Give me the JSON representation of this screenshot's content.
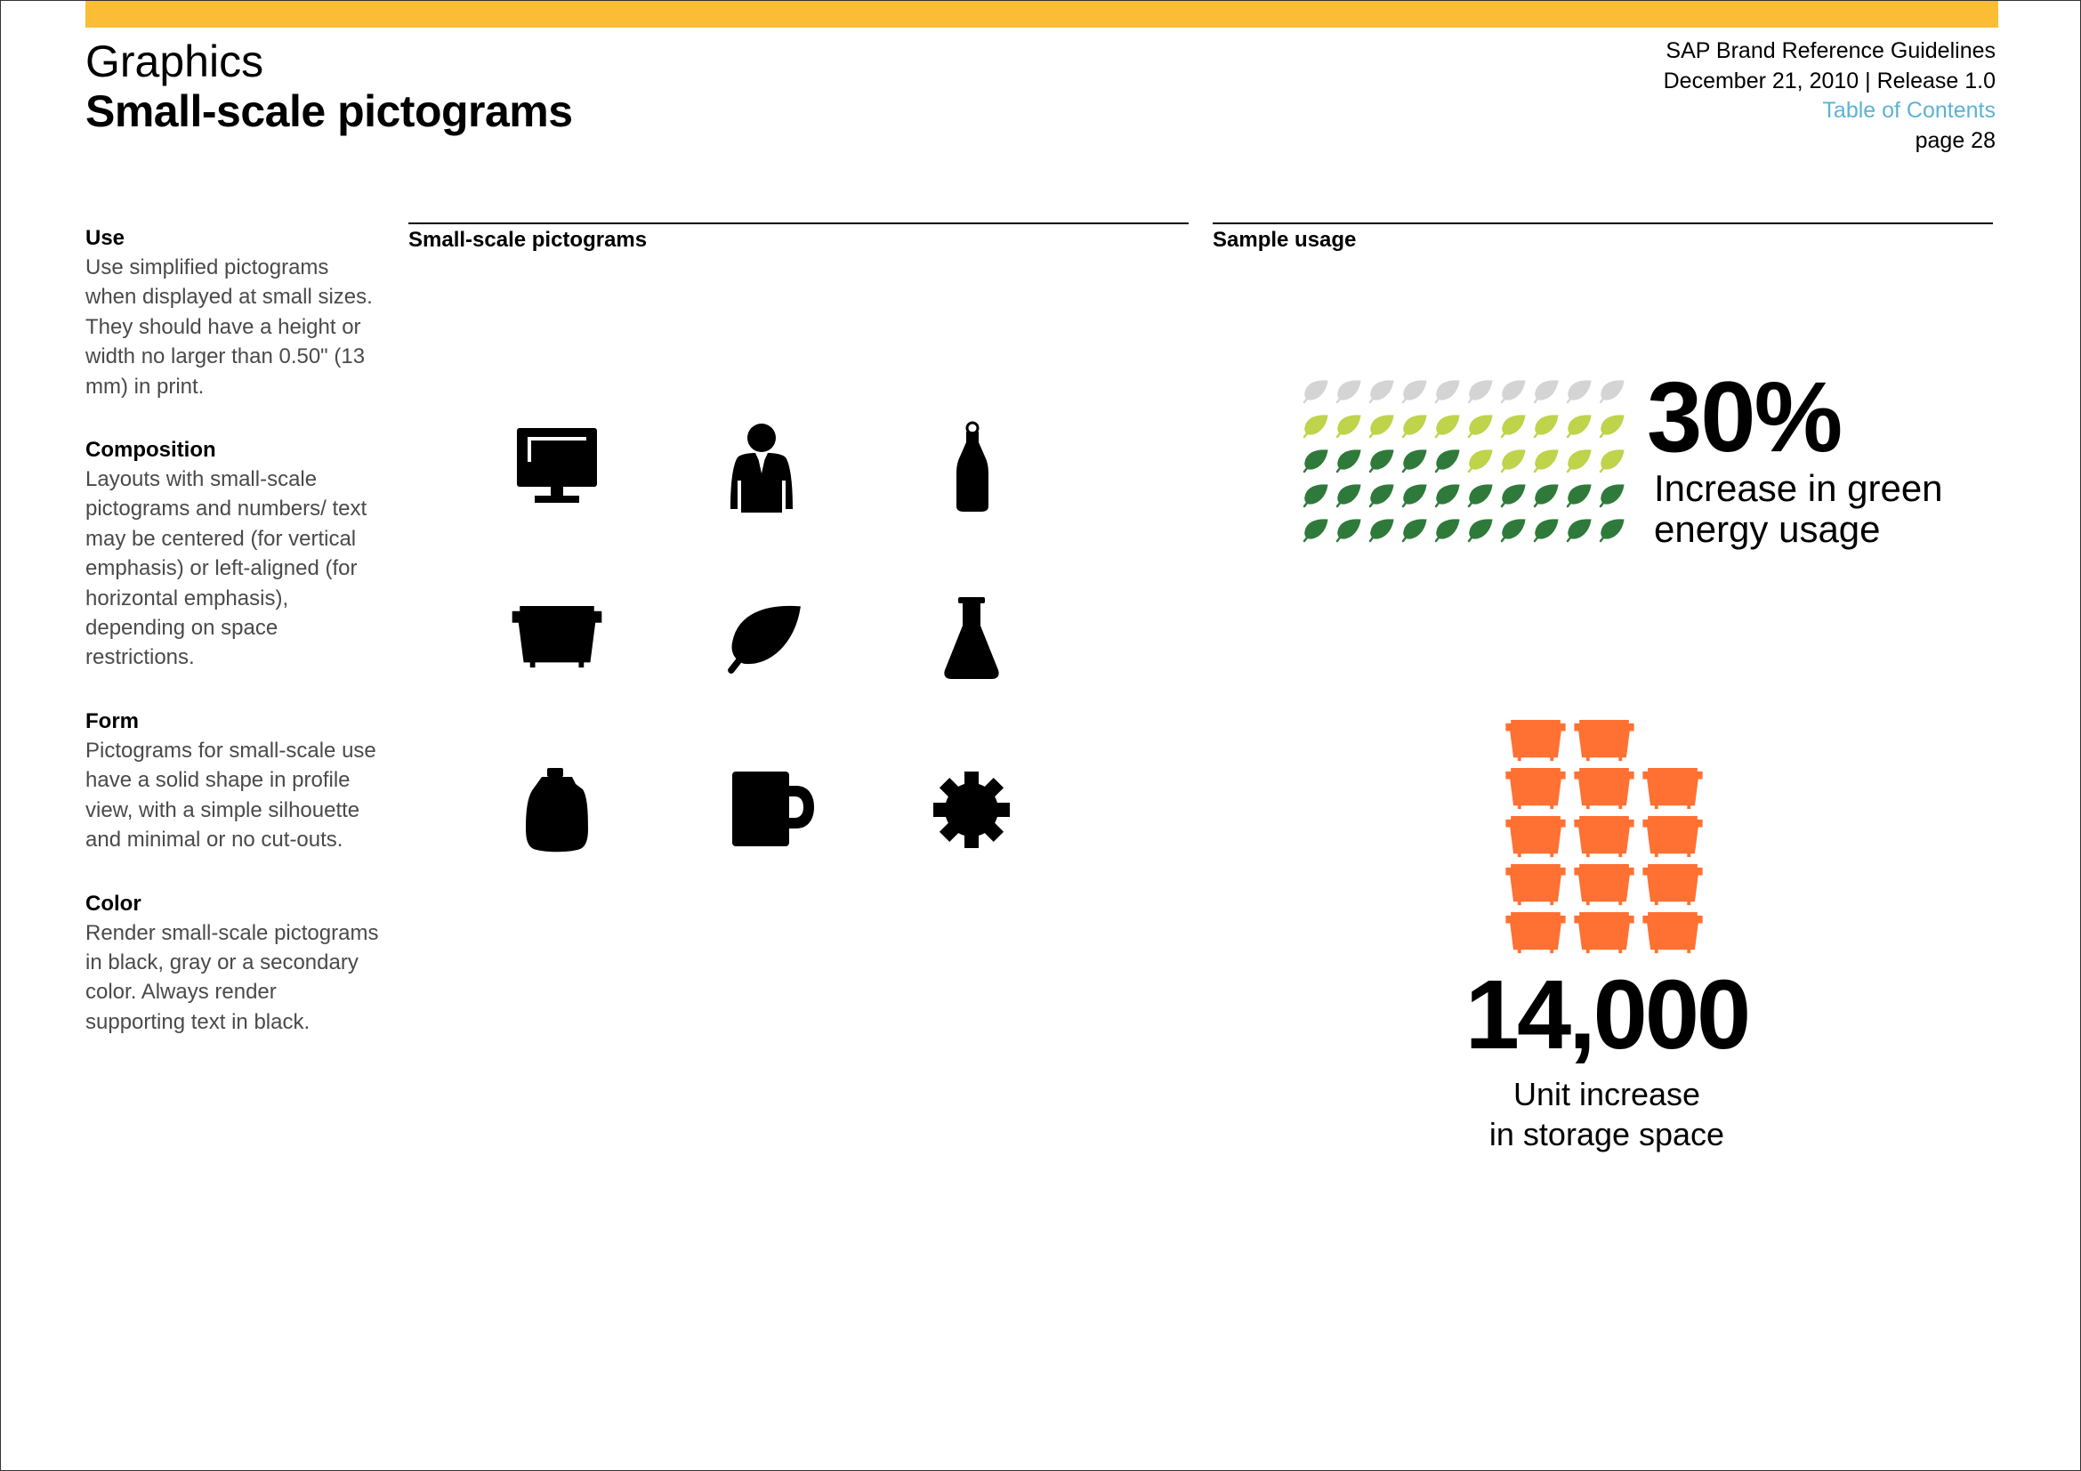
{
  "header": {
    "section": "Graphics",
    "title": "Small-scale pictograms",
    "doc_name": "SAP Brand Reference Guidelines",
    "doc_date": "December 21, 2010 | Release 1.0",
    "toc_link": "Table of Contents",
    "page": "page 28"
  },
  "colors": {
    "accent_bar": "#fbbd35",
    "toc_link": "#5bb3d3",
    "leaf_gray": "#d4d4d4",
    "leaf_light_green": "#bfd34b",
    "leaf_dark_green": "#2f7a3b",
    "bin_orange": "#ff7033"
  },
  "sidebar": [
    {
      "heading": "Use",
      "text": "Use simplified pictograms when displayed at small sizes. They should have a height or width no larger than 0.50\" (13 mm) in print."
    },
    {
      "heading": "Composition",
      "text": "Layouts with small-scale pictograms and numbers/ text may be centered (for vertical emphasis) or left-aligned (for horizontal emphasis), depending on space restrictions."
    },
    {
      "heading": "Form",
      "text": "Pictograms for small-scale use have a solid shape in profile view, with a simple silhouette and minimal or no cut-outs."
    },
    {
      "heading": "Color",
      "text": "Render small-scale pictograms in black, gray or a secondary color. Always render supporting text in black."
    }
  ],
  "columns": {
    "pictograms_heading": "Small-scale pictograms",
    "sample_heading": "Sample usage"
  },
  "pictograms": [
    "monitor-icon",
    "person-icon",
    "bottle-icon",
    "bin-icon",
    "leaf-icon",
    "flask-icon",
    "jug-icon",
    "mug-icon",
    "gear-icon"
  ],
  "sample_green": {
    "value": "30%",
    "line1": "Increase in green",
    "line2": "energy usage",
    "leaf_rows": [
      [
        "gray",
        "gray",
        "gray",
        "gray",
        "gray",
        "gray",
        "gray",
        "gray",
        "gray",
        "gray"
      ],
      [
        "light",
        "light",
        "light",
        "light",
        "light",
        "light",
        "light",
        "light",
        "light",
        "light"
      ],
      [
        "dark",
        "dark",
        "dark",
        "dark",
        "dark",
        "light",
        "light",
        "light",
        "light",
        "light"
      ],
      [
        "dark",
        "dark",
        "dark",
        "dark",
        "dark",
        "dark",
        "dark",
        "dark",
        "dark",
        "dark"
      ],
      [
        "dark",
        "dark",
        "dark",
        "dark",
        "dark",
        "dark",
        "dark",
        "dark",
        "dark",
        "dark"
      ]
    ]
  },
  "sample_storage": {
    "value": "14,000",
    "line1": "Unit increase",
    "line2": "in storage space",
    "bin_rows": [
      [
        1,
        1,
        0
      ],
      [
        1,
        1,
        1
      ],
      [
        1,
        1,
        1
      ],
      [
        1,
        1,
        1
      ],
      [
        1,
        1,
        1
      ]
    ]
  }
}
